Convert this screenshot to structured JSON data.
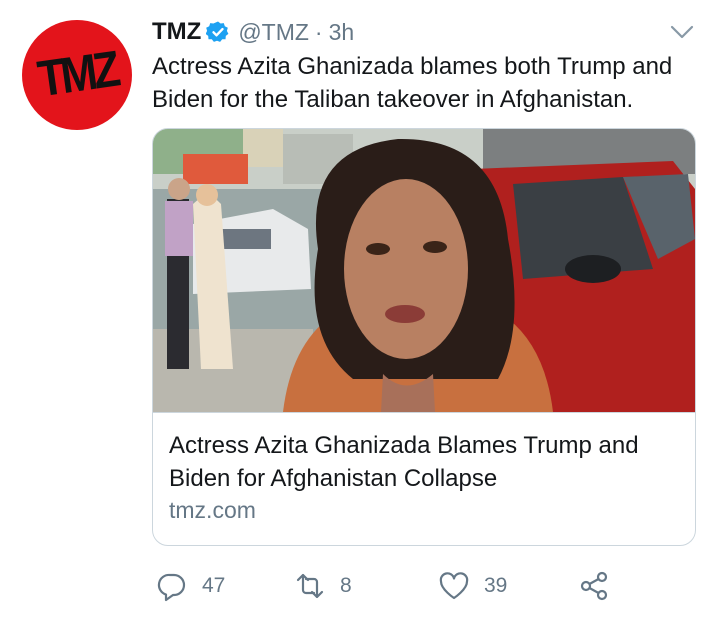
{
  "account": {
    "avatar_text": "TMZ",
    "name": "TMZ",
    "handle": "@TMZ",
    "separator": "·",
    "time": "3h"
  },
  "tweet": {
    "text": "Actress Azita Ghanizada blames both Trump and Biden for the Taliban takeover in Afghanistan."
  },
  "card": {
    "title": "Actress Azita Ghanizada Blames Trump and Biden for Afghanistan Collapse",
    "domain": "tmz.com"
  },
  "actions": {
    "replies": "47",
    "retweets": "8",
    "likes": "39"
  },
  "colors": {
    "brand_red": "#e3141b",
    "verified_blue": "#1da1f2",
    "muted_text": "#657786"
  },
  "icons": [
    "verified-badge-icon",
    "chevron-down-icon",
    "reply-icon",
    "retweet-icon",
    "like-icon",
    "share-icon"
  ]
}
